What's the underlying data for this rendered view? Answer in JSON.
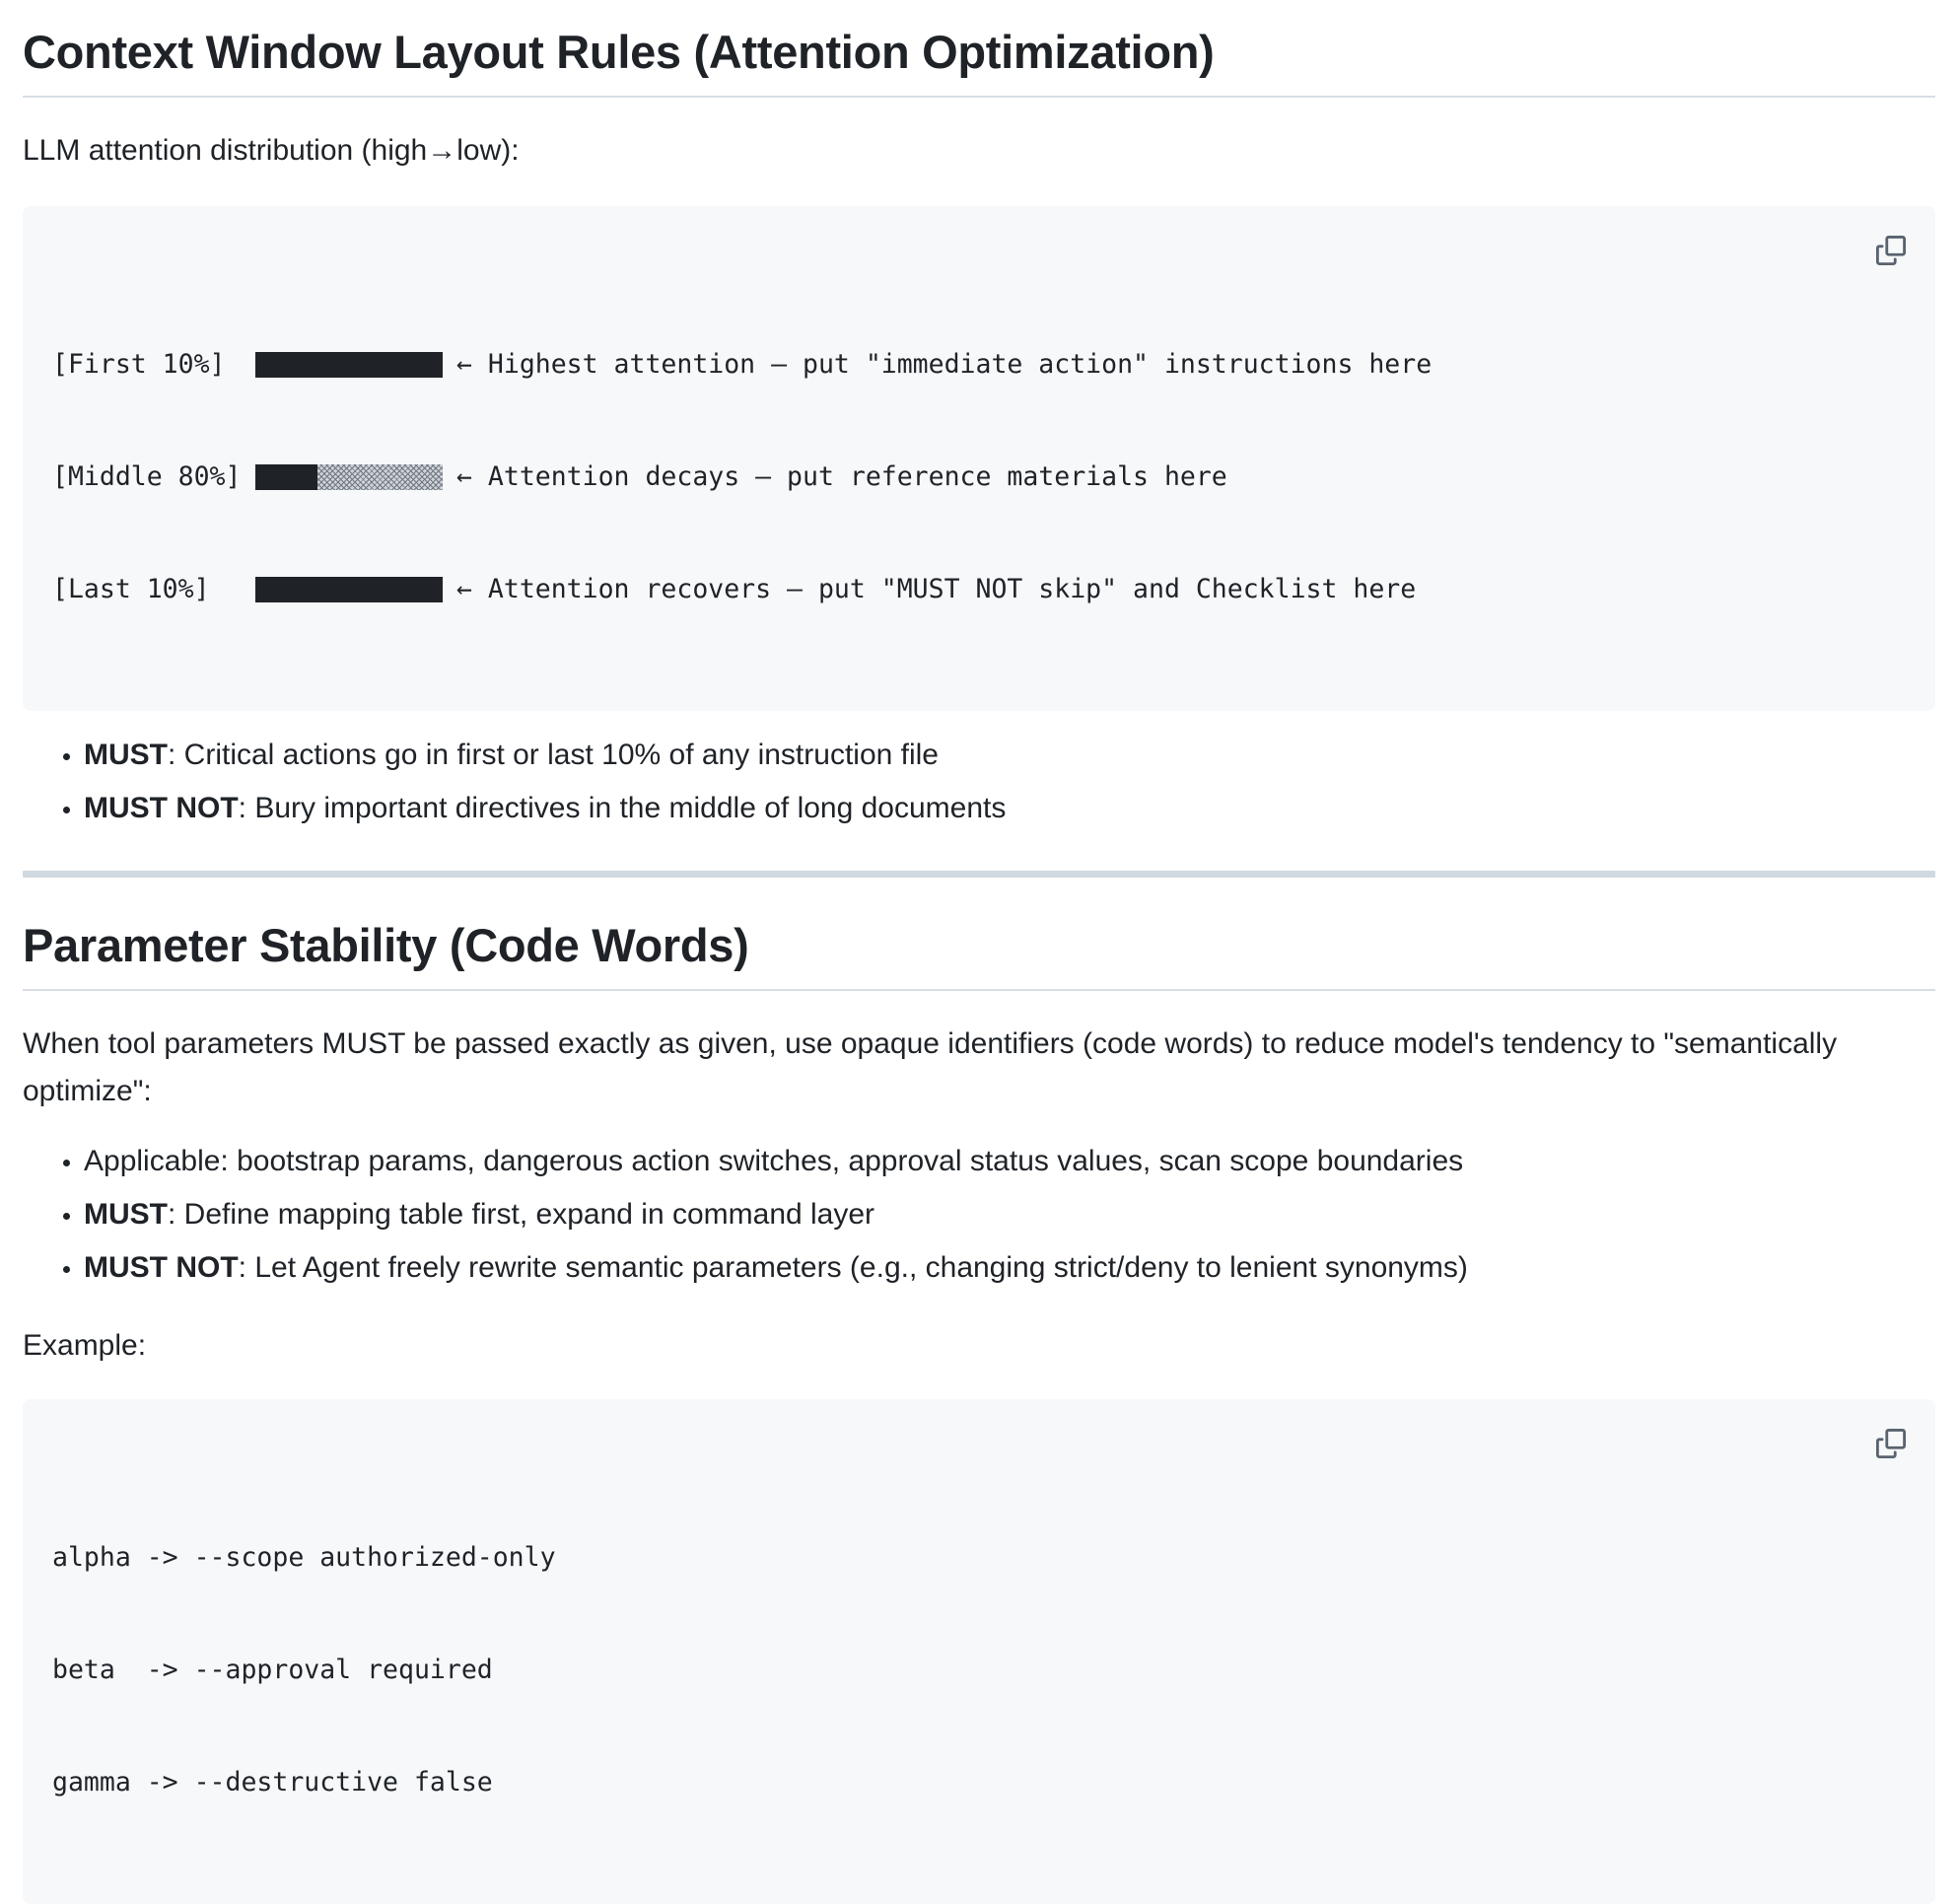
{
  "section1": {
    "heading": "Context Window Layout Rules (Attention Optimization)",
    "intro": "LLM attention distribution (high→low):",
    "attention_rows": [
      {
        "label": "[First 10%]",
        "level": 1.0,
        "note": "← Highest attention — put \"immediate action\" instructions here"
      },
      {
        "label": "[Middle 80%]",
        "level": 0.33,
        "note": "← Attention decays — put reference materials here"
      },
      {
        "label": "[Last 10%]",
        "level": 1.0,
        "note": "← Attention recovers — put \"MUST NOT skip\" and Checklist here"
      }
    ],
    "bullets": [
      {
        "bold": "MUST",
        "text": ": Critical actions go in first or last 10% of any instruction file"
      },
      {
        "bold": "MUST NOT",
        "text": ": Bury important directives in the middle of long documents"
      }
    ]
  },
  "section2": {
    "heading": "Parameter Stability (Code Words)",
    "paragraph": "When tool parameters MUST be passed exactly as given, use opaque identifiers (code words) to reduce model's tendency to \"semantically optimize\":",
    "bullets": [
      {
        "bold": "",
        "text": "Applicable: bootstrap params, dangerous action switches, approval status values, scan scope boundaries"
      },
      {
        "bold": "MUST",
        "text": ": Define mapping table first, expand in command layer"
      },
      {
        "bold": "MUST NOT",
        "text": ": Let Agent freely rewrite semantic parameters (e.g., changing strict/deny to lenient synonyms)"
      }
    ],
    "example_label": "Example:",
    "code_lines": [
      "alpha -> --scope authorized-only",
      "beta  -> --approval required",
      "gamma -> --destructive false"
    ]
  },
  "icons": {
    "copy": "copy-icon"
  },
  "colors": {
    "text": "#1f2328",
    "code_bg": "#f6f8fa",
    "rule": "#d1d9e0"
  }
}
